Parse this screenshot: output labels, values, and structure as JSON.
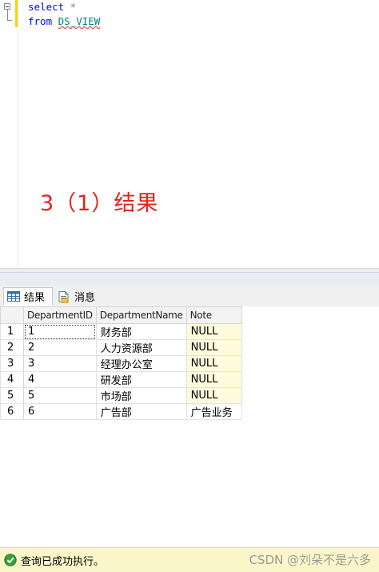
{
  "editor": {
    "line1": {
      "keyword": "select",
      "rest": " *"
    },
    "line2": {
      "keyword": "from",
      "identifier": "DS_VIEW"
    },
    "annotation": "3（1）结果"
  },
  "tabs": [
    {
      "label": "结果",
      "icon": "grid-icon",
      "active": true
    },
    {
      "label": "消息",
      "icon": "messages-icon",
      "active": false
    }
  ],
  "grid": {
    "columns": [
      "DepartmentID",
      "DepartmentName",
      "Note"
    ],
    "rows": [
      {
        "num": "1",
        "id": "1",
        "name": "财务部",
        "note": "NULL"
      },
      {
        "num": "2",
        "id": "2",
        "name": "人力资源部",
        "note": "NULL"
      },
      {
        "num": "3",
        "id": "3",
        "name": "经理办公室",
        "note": "NULL"
      },
      {
        "num": "4",
        "id": "4",
        "name": "研发部",
        "note": "NULL"
      },
      {
        "num": "5",
        "id": "5",
        "name": "市场部",
        "note": "NULL"
      },
      {
        "num": "6",
        "id": "6",
        "name": "广告部",
        "note": "广告业务"
      }
    ]
  },
  "status": {
    "text": "查询已成功执行。",
    "icon": "success-check-icon",
    "watermark": "CSDN @刘朵不是六多"
  },
  "colors": {
    "keyword": "#0000ff",
    "identifier": "#008080",
    "annotation": "#e8221b",
    "null_cell": "#fdfbdc",
    "status_bar": "#fbf6c9"
  }
}
